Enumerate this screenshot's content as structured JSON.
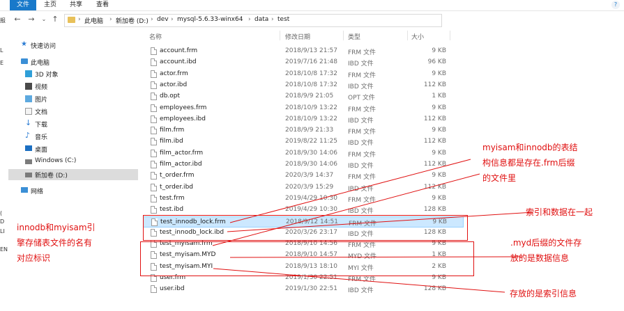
{
  "ribbon": {
    "file_tab": "文件",
    "home_tab": "主页",
    "share_tab": "共享",
    "view_tab": "查看"
  },
  "breadcrumb": [
    "此电脑",
    "新加卷 (D:)",
    "dev",
    "mysql-5.6.33-winx64",
    "data",
    "test"
  ],
  "edge_left": [
    "报",
    "L",
    "E",
    "(",
    "D",
    "LI",
    "EN"
  ],
  "nav": {
    "quick_access": "快速访问",
    "this_pc": "此电脑",
    "objects3d": "3D 对象",
    "videos": "视频",
    "pictures": "图片",
    "documents": "文档",
    "downloads": "下载",
    "music": "音乐",
    "desktop": "桌面",
    "windows_c": "Windows (C:)",
    "drive_d": "新加卷 (D:)",
    "network": "网络"
  },
  "columns": {
    "name": "名称",
    "date": "修改日期",
    "type": "类型",
    "size": "大小"
  },
  "files": [
    {
      "name": "account.frm",
      "date": "2018/9/13 21:57",
      "type": "FRM 文件",
      "size": "9 KB"
    },
    {
      "name": "account.ibd",
      "date": "2019/7/16 21:48",
      "type": "IBD 文件",
      "size": "96 KB"
    },
    {
      "name": "actor.frm",
      "date": "2018/10/8 17:32",
      "type": "FRM 文件",
      "size": "9 KB"
    },
    {
      "name": "actor.ibd",
      "date": "2018/10/8 17:32",
      "type": "IBD 文件",
      "size": "112 KB"
    },
    {
      "name": "db.opt",
      "date": "2018/9/9 21:05",
      "type": "OPT 文件",
      "size": "1 KB"
    },
    {
      "name": "employees.frm",
      "date": "2018/10/9 13:22",
      "type": "FRM 文件",
      "size": "9 KB"
    },
    {
      "name": "employees.ibd",
      "date": "2018/10/9 13:22",
      "type": "IBD 文件",
      "size": "112 KB"
    },
    {
      "name": "film.frm",
      "date": "2018/9/9 21:33",
      "type": "FRM 文件",
      "size": "9 KB"
    },
    {
      "name": "film.ibd",
      "date": "2019/8/22 11:25",
      "type": "IBD 文件",
      "size": "112 KB"
    },
    {
      "name": "film_actor.frm",
      "date": "2018/9/30 14:06",
      "type": "FRM 文件",
      "size": "9 KB"
    },
    {
      "name": "film_actor.ibd",
      "date": "2018/9/30 14:06",
      "type": "IBD 文件",
      "size": "112 KB"
    },
    {
      "name": "t_order.frm",
      "date": "2020/3/9 14:37",
      "type": "FRM 文件",
      "size": "9 KB"
    },
    {
      "name": "t_order.ibd",
      "date": "2020/3/9 15:29",
      "type": "IBD 文件",
      "size": "112 KB"
    },
    {
      "name": "test.frm",
      "date": "2019/4/29 10:30",
      "type": "FRM 文件",
      "size": "9 KB"
    },
    {
      "name": "test.ibd",
      "date": "2019/4/29 10:30",
      "type": "IBD 文件",
      "size": "128 KB"
    },
    {
      "name": "test_innodb_lock.frm",
      "date": "2018/9/12 14:51",
      "type": "FRM 文件",
      "size": "9 KB"
    },
    {
      "name": "test_innodb_lock.ibd",
      "date": "2020/3/26 23:17",
      "type": "IBD 文件",
      "size": "128 KB"
    },
    {
      "name": "test_myisam.frm",
      "date": "2018/9/10 14:56",
      "type": "FRM 文件",
      "size": "9 KB"
    },
    {
      "name": "test_myisam.MYD",
      "date": "2018/9/10 14:57",
      "type": "MYD 文件",
      "size": "1 KB"
    },
    {
      "name": "test_myisam.MYI",
      "date": "2018/9/13 18:10",
      "type": "MYI 文件",
      "size": "2 KB"
    },
    {
      "name": "user.frm",
      "date": "2019/1/30 22:51",
      "type": "FRM 文件",
      "size": "9 KB"
    },
    {
      "name": "user.ibd",
      "date": "2019/1/30 22:51",
      "type": "IBD 文件",
      "size": "128 KB"
    }
  ],
  "annotations": {
    "left_note": [
      "innodb和myisam引",
      "擎存储表文件的名有",
      "对应标识"
    ],
    "frm_note": [
      "myisam和innodb的表结",
      "构信息都是存在.frm后缀",
      "的文件里"
    ],
    "ibd_note": "索引和数据在一起",
    "myd_note": [
      ".myd后缀的文件存",
      "放的是数据信息"
    ],
    "myi_note": "存放的是索引信息",
    "annotation_color": "#e01010"
  },
  "colors": {
    "accent": "#1979ca",
    "selection": "#cce8ff"
  }
}
